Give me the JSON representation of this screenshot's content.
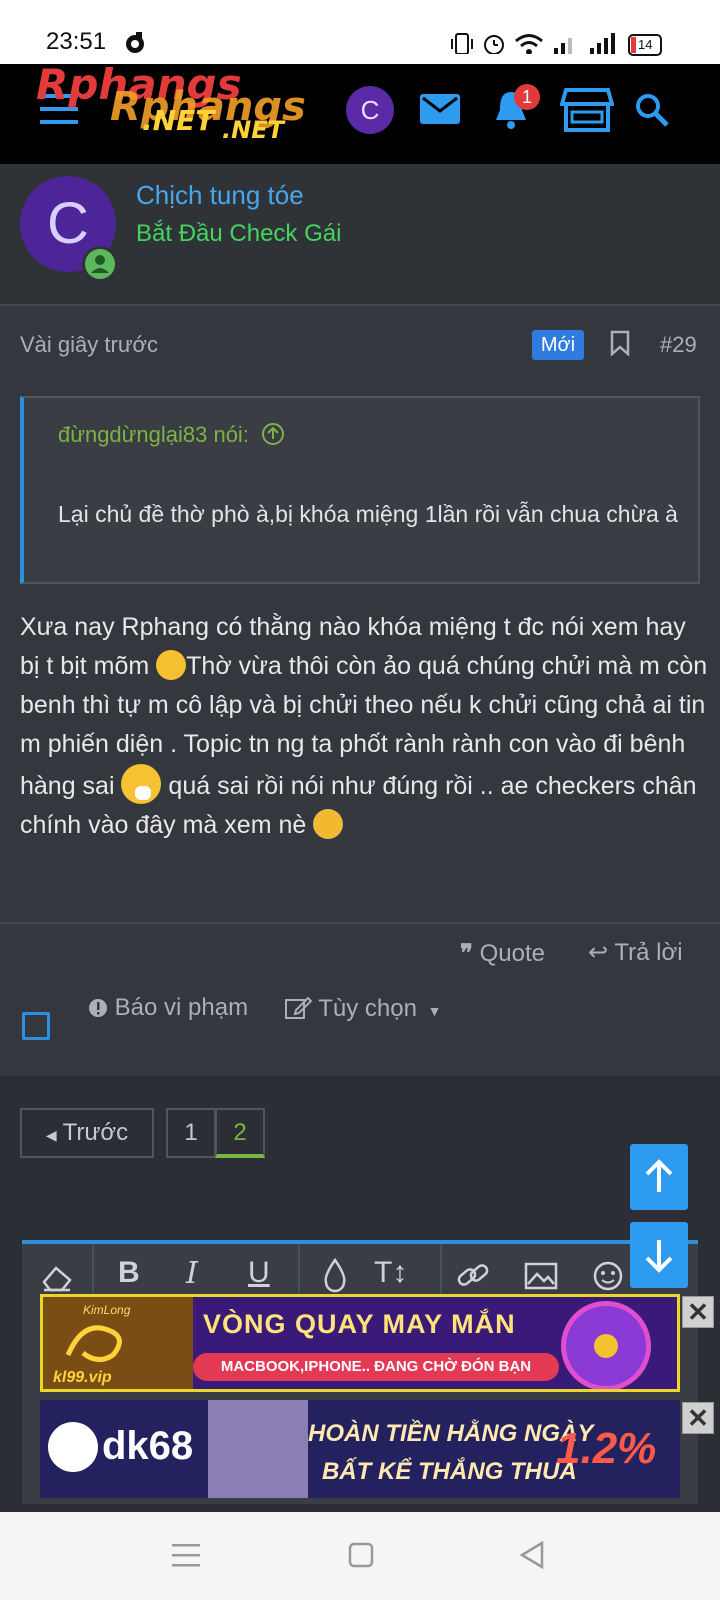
{
  "status_bar": {
    "time": "23:51",
    "battery": "14"
  },
  "header": {
    "logo_main": "Rphangs",
    "logo_sub": ".NET",
    "avatar_letter": "C",
    "notification_count": "1",
    "icons": [
      "menu-icon",
      "mail-icon",
      "bell-icon",
      "store-icon",
      "search-icon"
    ]
  },
  "user": {
    "avatar_letter": "C",
    "name": "Chịch tung tóe",
    "title": "Bắt Đầu Check Gái"
  },
  "post": {
    "time": "Vài giây trước",
    "new_badge": "Mới",
    "number": "#29",
    "quote_author": "đừngdừnglại83 nói:",
    "quote_text": "Lại chủ đề thờ phò à,bị khóa miệng 1lần rồi vẫn chua chừa à",
    "body": [
      "Xưa nay Rphang có thằng nào khóa miệng t đc nói xem hay bị t bịt mõm ",
      "Thờ vừa thôi còn ảo quá chúng chửi mà m còn benh thì tự m cô lập và bị chửi theo nếu k chửi cũng chả ai tin m phiến diện . Topic tn ng ta phốt rành rành con vào đi bênh hàng sai ",
      " quá sai rồi nói như đúng rồi .. ae checkers chân chính vào đây mà xem nè "
    ],
    "actions": {
      "quote": "Quote",
      "reply": "Trả lời",
      "report": "Báo vi phạm",
      "options": "Tùy chọn"
    }
  },
  "pagination": {
    "prev": "Trước",
    "pages": [
      "1",
      "2"
    ],
    "current": "2"
  },
  "ads": [
    {
      "title": "VÒNG QUAY MAY MẮN",
      "subtitle": "MACBOOK,IPHONE.. ĐANG CHỜ ĐÓN BẠN",
      "brand": "kl99.vip",
      "brand_top": "KimLong"
    },
    {
      "title1": "HOÀN TIỀN HẰNG NGÀY",
      "title2": "BẤT KỂ THẮNG THUA",
      "percent": "1.2%",
      "brand": "dk68"
    }
  ],
  "colors": {
    "accent": "#2d8fe0",
    "username": "#47a7eb",
    "user_title": "#43d45c",
    "quote_author": "#7cb342"
  }
}
